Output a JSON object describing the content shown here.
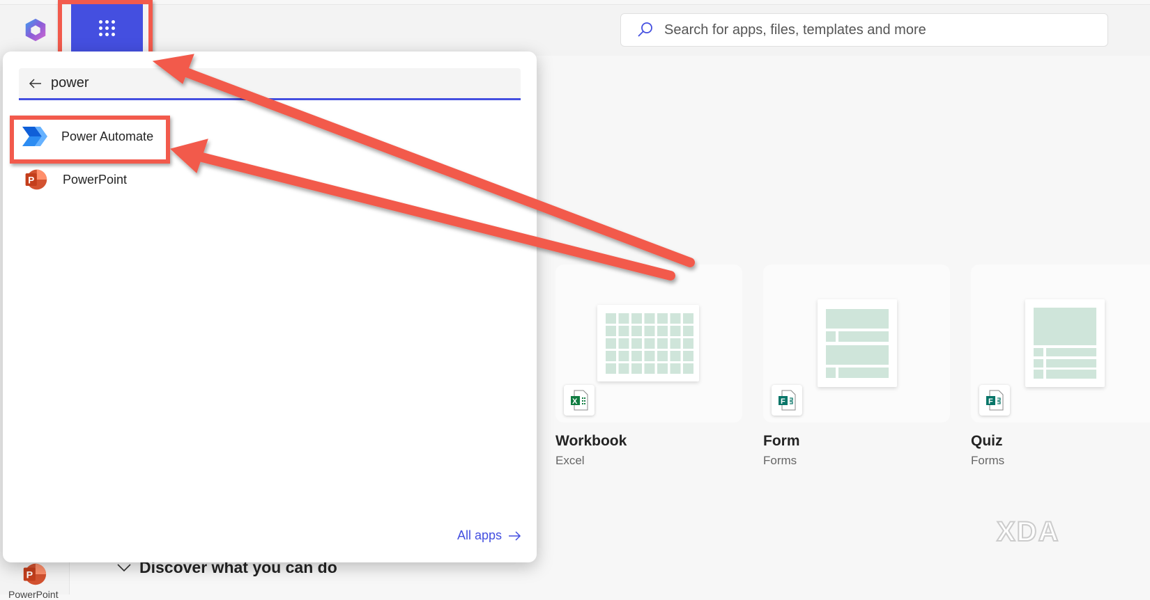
{
  "header": {
    "search_placeholder": "Search for apps, files, templates and more"
  },
  "app_launcher": {
    "search_value": "power",
    "results": [
      {
        "label": "Power Automate",
        "icon": "power-automate-icon"
      },
      {
        "label": "PowerPoint",
        "icon": "powerpoint-icon"
      }
    ],
    "all_apps_label": "All apps"
  },
  "rail": {
    "powerpoint_label": "PowerPoint"
  },
  "discover_label": "Discover what you can do",
  "templates": [
    {
      "title": "Workbook",
      "app": "Excel"
    },
    {
      "title": "Form",
      "app": "Forms"
    },
    {
      "title": "Quiz",
      "app": "Forms"
    }
  ],
  "watermark": "XDA",
  "colors": {
    "accent": "#444fe0",
    "annotation": "#f25a4c"
  }
}
